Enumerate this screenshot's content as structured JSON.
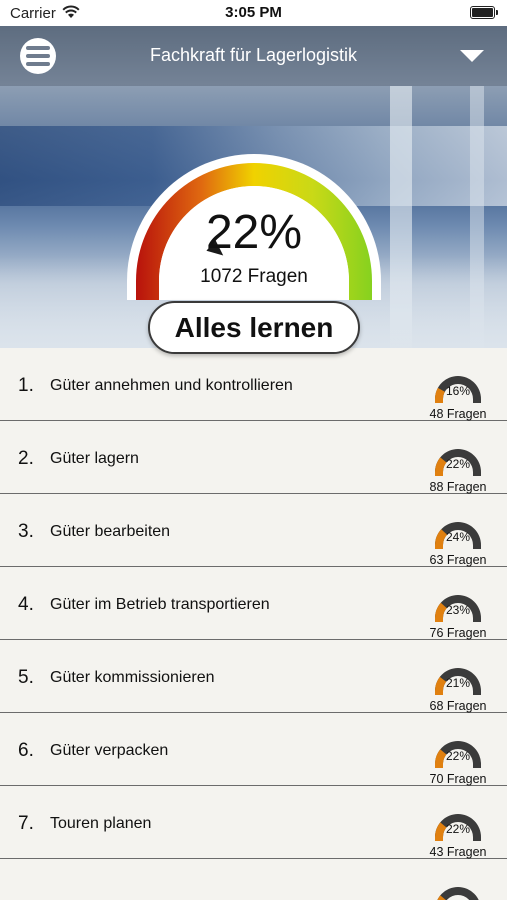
{
  "status": {
    "carrier": "Carrier",
    "time": "3:05 PM"
  },
  "nav": {
    "title": "Fachkraft für Lagerlogistik"
  },
  "overall": {
    "percent": "22%",
    "questions": "1072 Fragen",
    "progress": 0.22
  },
  "learn_all_label": "Alles lernen",
  "topics": [
    {
      "num": "1.",
      "label": "Güter annehmen und kontrollieren",
      "percent": "16%",
      "questions": "48 Fragen",
      "progress": 0.16
    },
    {
      "num": "2.",
      "label": "Güter lagern",
      "percent": "22%",
      "questions": "88 Fragen",
      "progress": 0.22
    },
    {
      "num": "3.",
      "label": "Güter bearbeiten",
      "percent": "24%",
      "questions": "63 Fragen",
      "progress": 0.24
    },
    {
      "num": "4.",
      "label": "Güter im Betrieb transportieren",
      "percent": "23%",
      "questions": "76 Fragen",
      "progress": 0.23
    },
    {
      "num": "5.",
      "label": "Güter kommissionieren",
      "percent": "21%",
      "questions": "68 Fragen",
      "progress": 0.21
    },
    {
      "num": "6.",
      "label": "Güter verpacken",
      "percent": "22%",
      "questions": "70 Fragen",
      "progress": 0.22
    },
    {
      "num": "7.",
      "label": "Touren planen",
      "percent": "22%",
      "questions": "43 Fragen",
      "progress": 0.22
    },
    {
      "num": "",
      "label": "",
      "percent": "",
      "questions": "",
      "progress": 0.22
    }
  ],
  "colors": {
    "gauge_low": "#c0170f",
    "gauge_mid": "#f0d000",
    "gauge_high": "#8fd11e",
    "mini_fill": "#e08010",
    "mini_track": "#3b3b3b"
  }
}
